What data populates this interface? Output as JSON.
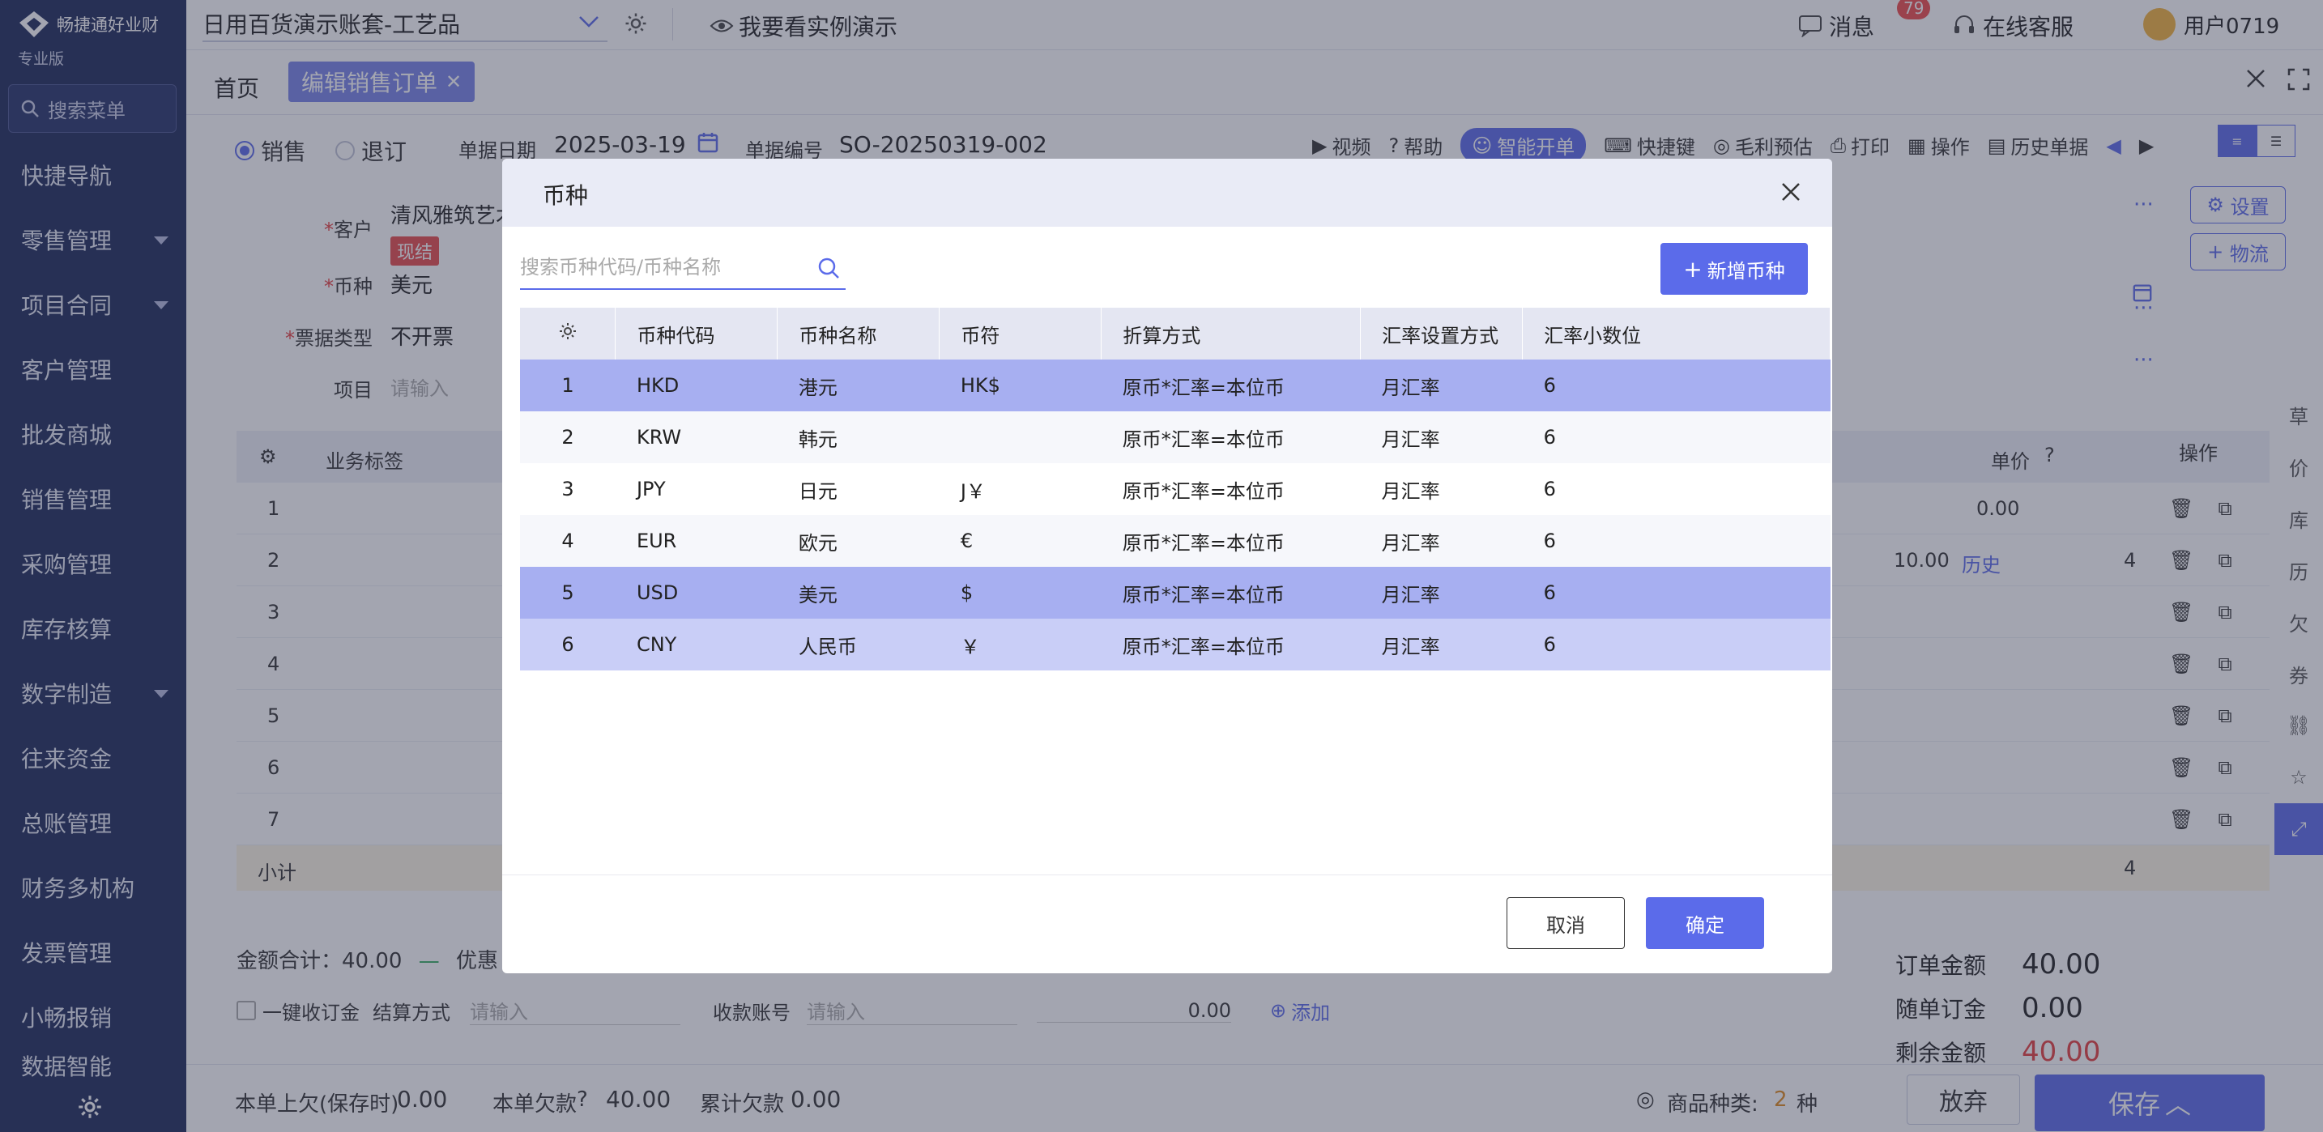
{
  "brand": {
    "name": "畅捷通好业财",
    "edition": "专业版"
  },
  "sidebar": {
    "search_label": "搜索菜单",
    "items": [
      {
        "label": "快捷导航"
      },
      {
        "label": "零售管理"
      },
      {
        "label": "项目合同"
      },
      {
        "label": "客户管理"
      },
      {
        "label": "批发商城"
      },
      {
        "label": "销售管理"
      },
      {
        "label": "采购管理"
      },
      {
        "label": "库存核算"
      },
      {
        "label": "数字制造"
      },
      {
        "label": "往来资金"
      },
      {
        "label": "总账管理"
      },
      {
        "label": "财务多机构"
      },
      {
        "label": "发票管理"
      },
      {
        "label": "小畅报销"
      },
      {
        "label": "数据智能"
      }
    ]
  },
  "topbar": {
    "account": "日用百货演示账套-工艺品",
    "demo_link": "我要看实例演示",
    "messages_label": "消息",
    "messages_count": "79",
    "service_label": "在线客服",
    "user": "用户0719"
  },
  "tabs": {
    "home": "首页",
    "active": "编辑销售订单"
  },
  "order": {
    "radio_sale": "销售",
    "radio_return": "退订",
    "date_label": "单据日期",
    "date": "2025-03-19",
    "no_label": "单据编号",
    "no": "SO-20250319-002",
    "toolbar": [
      "视频",
      "帮助",
      "智能开单",
      "快捷键",
      "毛利预估",
      "打印",
      "操作",
      "历史单据"
    ],
    "customer_label": "客户",
    "customer": "清风雅筑艺术",
    "customer_tag": "现结",
    "currency_label": "币种",
    "currency": "美元",
    "invoice_label": "票据类型",
    "invoice": "不开票",
    "project_label": "项目",
    "project_placeholder": "请输入",
    "btn_settings": "设置",
    "btn_logistics": "物流"
  },
  "grid": {
    "headers": {
      "tag": "业务标签",
      "price": "单价",
      "ops": "操作"
    },
    "rows": [
      "1",
      "2",
      "3",
      "4",
      "5",
      "6",
      "7"
    ],
    "row1_price": "0.00",
    "row2_price": "10.00",
    "row2_history": "历史",
    "row2_qty": "4",
    "subtotal_label": "小计",
    "subtotal_qty": "4"
  },
  "bottom": {
    "amount_total": "金额合计：40.00",
    "discount": "优惠",
    "collect_label": "一键收订金",
    "settle_label": "结算方式",
    "settle_placeholder": "请输入",
    "account_label": "收款账号",
    "account_placeholder": "请输入",
    "amount": "0.00",
    "add_label": "添加"
  },
  "totals": [
    {
      "k": "订单金额",
      "v": "40.00"
    },
    {
      "k": "随单订金",
      "v": "0.00"
    },
    {
      "k": "剩余金额",
      "v": "40.00"
    }
  ],
  "footer": {
    "prev_debt_label": "本单上欠(保存时)",
    "prev_debt": "0.00",
    "debt_label": "本单欠款",
    "debt": "40.00",
    "acc_debt_label": "累计欠款",
    "acc_debt": "0.00",
    "goods_types_label": "商品种类:",
    "goods_types": "2",
    "goods_types_unit": "种",
    "abandon": "放弃",
    "save": "保存"
  },
  "right_rail": [
    "草",
    "价",
    "库",
    "历",
    "欠",
    "券"
  ],
  "modal": {
    "title": "币种",
    "search_placeholder": "搜索币种代码/币种名称",
    "add_button": "新增币种",
    "columns": [
      "币种代码",
      "币种名称",
      "币符",
      "折算方式",
      "汇率设置方式",
      "汇率小数位"
    ],
    "rows": [
      {
        "no": "1",
        "code": "HKD",
        "name": "港元",
        "symbol": "HK$",
        "method": "原币*汇率=本位币",
        "rate_mode": "月汇率",
        "decimals": "6"
      },
      {
        "no": "2",
        "code": "KRW",
        "name": "韩元",
        "symbol": "",
        "method": "原币*汇率=本位币",
        "rate_mode": "月汇率",
        "decimals": "6"
      },
      {
        "no": "3",
        "code": "JPY",
        "name": "日元",
        "symbol": "J￥",
        "method": "原币*汇率=本位币",
        "rate_mode": "月汇率",
        "decimals": "6"
      },
      {
        "no": "4",
        "code": "EUR",
        "name": "欧元",
        "symbol": "€",
        "method": "原币*汇率=本位币",
        "rate_mode": "月汇率",
        "decimals": "6"
      },
      {
        "no": "5",
        "code": "USD",
        "name": "美元",
        "symbol": "$",
        "method": "原币*汇率=本位币",
        "rate_mode": "月汇率",
        "decimals": "6"
      },
      {
        "no": "6",
        "code": "CNY",
        "name": "人民币",
        "symbol": "￥",
        "method": "原币*汇率=本位币",
        "rate_mode": "月汇率",
        "decimals": "6"
      }
    ],
    "cancel": "取消",
    "confirm": "确定"
  },
  "colors": {
    "accent": "#5b6bea",
    "sidebar": "#1e2a5a",
    "selected_row": "#a7aff1",
    "danger": "#e53e3e"
  }
}
